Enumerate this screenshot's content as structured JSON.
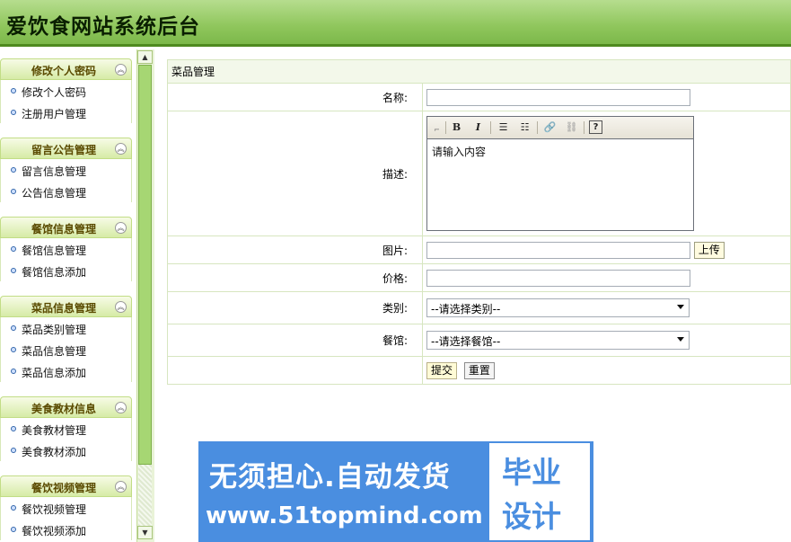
{
  "header": {
    "title": "爱饮食网站系统后台"
  },
  "sidebar": {
    "groups": [
      {
        "label": "修改个人密码",
        "items": [
          {
            "label": "修改个人密码"
          },
          {
            "label": "注册用户管理"
          }
        ]
      },
      {
        "label": "留言公告管理",
        "items": [
          {
            "label": "留言信息管理"
          },
          {
            "label": "公告信息管理"
          }
        ]
      },
      {
        "label": "餐馆信息管理",
        "items": [
          {
            "label": "餐馆信息管理"
          },
          {
            "label": "餐馆信息添加"
          }
        ]
      },
      {
        "label": "菜品信息管理",
        "items": [
          {
            "label": "菜品类别管理"
          },
          {
            "label": "菜品信息管理"
          },
          {
            "label": "菜品信息添加"
          }
        ]
      },
      {
        "label": "美食教材信息",
        "items": [
          {
            "label": "美食教材管理"
          },
          {
            "label": "美食教材添加"
          }
        ]
      },
      {
        "label": "餐饮视频管理",
        "items": [
          {
            "label": "餐饮视频管理"
          },
          {
            "label": "餐饮视频添加"
          }
        ]
      }
    ]
  },
  "form": {
    "section_title": "菜品管理",
    "name_label": "名称:",
    "name_value": "",
    "desc_label": "描述:",
    "editor_placeholder": "请输入内容",
    "image_label": "图片:",
    "image_value": "",
    "upload_label": "上传",
    "price_label": "价格:",
    "price_value": "",
    "category_label": "类别:",
    "category_selected": "--请选择类别--",
    "restaurant_label": "餐馆:",
    "restaurant_selected": "--请选择餐馆--",
    "submit_label": "提交",
    "reset_label": "重置"
  },
  "watermark": {
    "slogan": "无须担心.自动发货",
    "url": "www.51topmind.com",
    "side_line1": "毕业",
    "side_line2": "设计"
  }
}
